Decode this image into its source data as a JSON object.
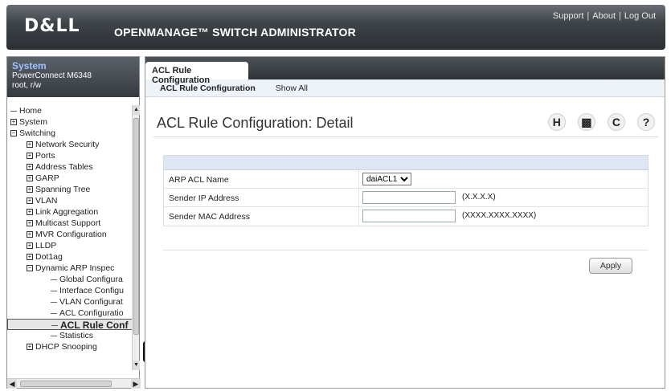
{
  "header": {
    "logo": "D&LL",
    "app_title": "OPENMANAGE™ SWITCH ADMINISTRATOR",
    "links": [
      "Support",
      "About",
      "Log Out"
    ]
  },
  "system": {
    "title": "System",
    "device": "PowerConnect M6348",
    "user": "root, r/w"
  },
  "tree": [
    {
      "label": "Home",
      "level": 0,
      "kind": "leaf-root"
    },
    {
      "label": "System",
      "level": 0,
      "kind": "plus"
    },
    {
      "label": "Switching",
      "level": 0,
      "kind": "minus"
    },
    {
      "label": "Network Security",
      "level": 1,
      "kind": "plus"
    },
    {
      "label": "Ports",
      "level": 1,
      "kind": "plus"
    },
    {
      "label": "Address Tables",
      "level": 1,
      "kind": "plus"
    },
    {
      "label": "GARP",
      "level": 1,
      "kind": "plus"
    },
    {
      "label": "Spanning Tree",
      "level": 1,
      "kind": "plus"
    },
    {
      "label": "VLAN",
      "level": 1,
      "kind": "plus"
    },
    {
      "label": "Link Aggregation",
      "level": 1,
      "kind": "plus"
    },
    {
      "label": "Multicast Support",
      "level": 1,
      "kind": "plus"
    },
    {
      "label": "MVR Configuration",
      "level": 1,
      "kind": "plus"
    },
    {
      "label": "LLDP",
      "level": 1,
      "kind": "plus"
    },
    {
      "label": "Dot1ag",
      "level": 1,
      "kind": "plus"
    },
    {
      "label": "Dynamic ARP Inspec",
      "level": 1,
      "kind": "minus"
    },
    {
      "label": "Global Configura",
      "level": 2,
      "kind": "leaf"
    },
    {
      "label": "Interface Configu",
      "level": 2,
      "kind": "leaf"
    },
    {
      "label": "VLAN Configurat",
      "level": 2,
      "kind": "leaf"
    },
    {
      "label": "ACL Configuratio",
      "level": 2,
      "kind": "leaf"
    },
    {
      "label": "ACL Rule Conf",
      "level": 2,
      "kind": "selected"
    },
    {
      "label": "Statistics",
      "level": 2,
      "kind": "leaf"
    },
    {
      "label": "DHCP Snooping",
      "level": 1,
      "kind": "plus"
    }
  ],
  "tabs": {
    "main": "ACL Rule Configuration",
    "sub": [
      "ACL Rule Configuration",
      "Show All"
    ]
  },
  "page": {
    "title": "ACL Rule Configuration: Detail",
    "action_icons": [
      "save-icon",
      "print-icon",
      "refresh-icon",
      "help-icon"
    ]
  },
  "form": {
    "arp_acl_label": "ARP ACL Name",
    "arp_acl_value": "daiACL1",
    "sender_ip_label": "Sender IP Address",
    "sender_ip_value": "",
    "sender_ip_hint": "(X.X.X.X)",
    "sender_mac_label": "Sender MAC Address",
    "sender_mac_value": "",
    "sender_mac_hint": "(XXXX.XXXX.XXXX)"
  },
  "apply_label": "Apply"
}
